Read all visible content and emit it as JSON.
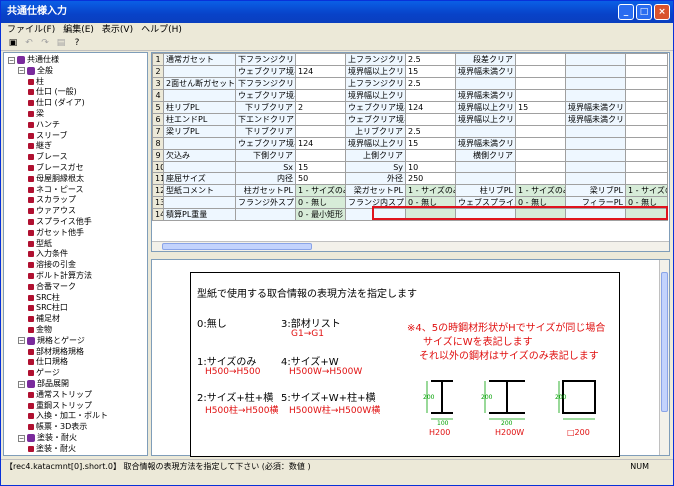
{
  "window": {
    "title": "共通仕様入力"
  },
  "menu": [
    "ファイル(F)",
    "編集(E)",
    "表示(V)",
    "ヘルプ(H)"
  ],
  "tree": [
    {
      "label": "共通仕様",
      "level": 0,
      "kind": "root",
      "expander": "−"
    },
    {
      "label": "全般",
      "level": 1,
      "kind": "folder",
      "expander": "−"
    },
    {
      "label": "柱",
      "level": 2,
      "kind": "item"
    },
    {
      "label": "仕口 (一般)",
      "level": 2,
      "kind": "item"
    },
    {
      "label": "仕口 (ダイア)",
      "level": 2,
      "kind": "item"
    },
    {
      "label": "梁",
      "level": 2,
      "kind": "item"
    },
    {
      "label": "ハンチ",
      "level": 2,
      "kind": "item"
    },
    {
      "label": "スリーブ",
      "level": 2,
      "kind": "item"
    },
    {
      "label": "継ぎ",
      "level": 2,
      "kind": "item"
    },
    {
      "label": "ブレース",
      "level": 2,
      "kind": "item"
    },
    {
      "label": "ブレースガセ",
      "level": 2,
      "kind": "item"
    },
    {
      "label": "母屋胴縁根太",
      "level": 2,
      "kind": "item"
    },
    {
      "label": "ネコ・ピース",
      "level": 2,
      "kind": "item"
    },
    {
      "label": "スカラップ",
      "level": 2,
      "kind": "item"
    },
    {
      "label": "ウァアウス",
      "level": 2,
      "kind": "item"
    },
    {
      "label": "スプライス他手",
      "level": 2,
      "kind": "item"
    },
    {
      "label": "ガセット他手",
      "level": 2,
      "kind": "item"
    },
    {
      "label": "型紙",
      "level": 2,
      "kind": "item"
    },
    {
      "label": "入力条件",
      "level": 2,
      "kind": "item"
    },
    {
      "label": "溶接の引金",
      "level": 2,
      "kind": "item"
    },
    {
      "label": "ボルト計算方法",
      "level": 2,
      "kind": "item"
    },
    {
      "label": "合番マーク",
      "level": 2,
      "kind": "item"
    },
    {
      "label": "SRC柱",
      "level": 2,
      "kind": "item"
    },
    {
      "label": "SRC柱口",
      "level": 2,
      "kind": "item"
    },
    {
      "label": "補足材",
      "level": 2,
      "kind": "item"
    },
    {
      "label": "金物",
      "level": 2,
      "kind": "item"
    },
    {
      "label": "規格とゲージ",
      "level": 1,
      "kind": "folder",
      "expander": "−"
    },
    {
      "label": "部材規格規格",
      "level": 2,
      "kind": "item"
    },
    {
      "label": "仕口規格",
      "level": 2,
      "kind": "item"
    },
    {
      "label": "ゲージ",
      "level": 2,
      "kind": "item"
    },
    {
      "label": "部品展開",
      "level": 1,
      "kind": "folder",
      "expander": "−"
    },
    {
      "label": "通常ストリップ",
      "level": 2,
      "kind": "item"
    },
    {
      "label": "重鋼ストリップ",
      "level": 2,
      "kind": "item"
    },
    {
      "label": "入換・加工・ボルト",
      "level": 2,
      "kind": "item"
    },
    {
      "label": "帳票・3D表示",
      "level": 2,
      "kind": "item"
    },
    {
      "label": "塗装・耐火",
      "level": 1,
      "kind": "folder",
      "expander": "−"
    },
    {
      "label": "塗装・耐火",
      "level": 2,
      "kind": "item"
    }
  ],
  "grid_rows": [
    [
      "1",
      "通常ガセット",
      "下フランジクリア",
      "",
      "上フランジクリア",
      "2.5",
      "段差クリア",
      "",
      "",
      ""
    ],
    [
      "2",
      "",
      "ウェブクリア境界幅",
      "124",
      "境界幅以上クリア",
      "15",
      "境界幅未満クリア",
      "",
      "",
      ""
    ],
    [
      "3",
      "2面せん断ガセット",
      "下フランジクリア",
      "",
      "上フランジクリア",
      "2.5",
      "",
      "",
      "",
      ""
    ],
    [
      "4",
      "",
      "ウェブクリア境界幅",
      "",
      "境界幅以上クリア",
      "",
      "境界幅未満クリア",
      "",
      "",
      ""
    ],
    [
      "5",
      "柱リブPL",
      "下リブクリア",
      "2",
      "ウェブクリア境界幅",
      "124",
      "境界幅以上クリア",
      "15",
      "境界幅未満クリア",
      ""
    ],
    [
      "6",
      "柱エンドPL",
      "下エンドクリア",
      "",
      "ウェブクリア境界幅",
      "",
      "境界幅以上クリア",
      "",
      "境界幅未満クリア",
      ""
    ],
    [
      "7",
      "梁リブPL",
      "下リブクリア",
      "",
      "上リブクリア",
      "2.5",
      "",
      "",
      "",
      ""
    ],
    [
      "8",
      "",
      "ウェブクリア境界幅",
      "124",
      "境界幅以上クリア",
      "15",
      "境界幅未満クリア",
      "",
      "",
      ""
    ],
    [
      "9",
      "欠込み",
      "下側クリア",
      "",
      "上側クリア",
      "",
      "横側クリア",
      "",
      "",
      ""
    ],
    [
      "10",
      "",
      "Sx",
      "15",
      "Sy",
      "10",
      "",
      "",
      "",
      ""
    ],
    [
      "11",
      "座屈サイズ",
      "内径",
      "50",
      "外径",
      "250",
      "",
      "",
      "",
      ""
    ],
    [
      "12",
      "型紙コメント",
      "柱ガセットPL",
      "1 - サイズのみ",
      "梁ガセットPL",
      "1 - サイズのみ",
      "柱リブPL",
      "1 - サイズのみ",
      "梁リブPL",
      "1 - サイズのみ"
    ],
    [
      "13",
      "",
      "フランジ外スプライス",
      "0 - 無し",
      "フランジ内スプライス",
      "0 - 無し",
      "ウェブスプライス",
      "0 - 無し",
      "フィラーPL",
      "0 - 無し"
    ],
    [
      "14",
      "積算PL重量",
      "",
      "0 - 最小矩形",
      "",
      "",
      "",
      "",
      "",
      ""
    ]
  ],
  "description": {
    "heading": "型紙で使用する取合情報の表現方法を指定します",
    "options": [
      {
        "label": "0:無し",
        "example": ""
      },
      {
        "label": "1:サイズのみ",
        "example": "H500→H500"
      },
      {
        "label": "2:サイズ+柱+横",
        "example": "H500柱→H500横"
      },
      {
        "label": "3:部材リスト",
        "example": "G1→G1"
      },
      {
        "label": "4:サイズ+W",
        "example": "H500W→H500W"
      },
      {
        "label": "5:サイズ+W+柱+横",
        "example": "H500W柱→H500W横"
      }
    ],
    "note_lines": [
      "※4、5の時鋼材形状がHでサイズが同じ場合",
      "サイズにWを表記します",
      "それ以外の鋼材はサイズのみ表記します"
    ],
    "shape_labels": [
      "H200",
      "H200W",
      "□200"
    ],
    "dim_labels": [
      "200",
      "100",
      "200",
      "200",
      "200"
    ]
  },
  "status": {
    "text": "【rec4.katacmnt[0].short.0】 取合情報の表現方法を指定して下さい (必須：数値 )",
    "num": "NUM"
  }
}
